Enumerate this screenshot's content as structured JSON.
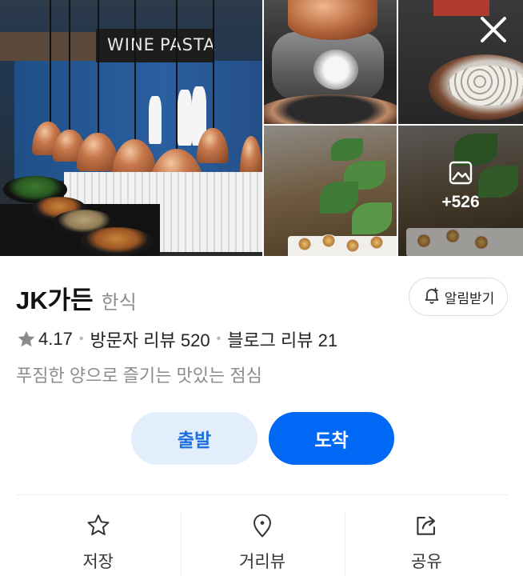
{
  "gallery": {
    "main_sign_left": "WINE",
    "main_sign_right": "PASTA",
    "more_count": "+526",
    "icons": {
      "close": "close-icon",
      "more": "image-icon"
    }
  },
  "place": {
    "name": "JK가든",
    "category": "한식",
    "rating": "4.17",
    "visitor_reviews": "방문자 리뷰 520",
    "blog_reviews": "블로그 리뷰 21",
    "description": "푸짐한 양으로 즐기는 맛있는 점심"
  },
  "alarm": {
    "label": "알림받기",
    "icon": "bell-plus-icon"
  },
  "route": {
    "depart_label": "출발",
    "arrive_label": "도착"
  },
  "actions": [
    {
      "label": "저장",
      "icon": "star-outline-icon"
    },
    {
      "label": "거리뷰",
      "icon": "location-pin-icon"
    },
    {
      "label": "공유",
      "icon": "share-icon"
    }
  ],
  "colors": {
    "accent": "#0068f5",
    "accent_soft": "#e3eefc",
    "accent_text": "#1e6fe0",
    "muted": "#8c8c8c"
  }
}
